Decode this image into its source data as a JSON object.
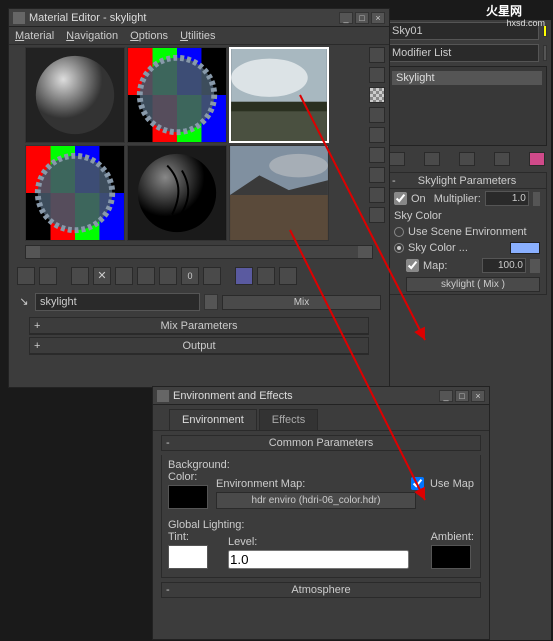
{
  "logo_text": "火星网",
  "logo_sub": "hxsd.com",
  "materialEditor": {
    "title": "Material Editor - skylight",
    "menu": {
      "material": "Material",
      "navigation": "Navigation",
      "options": "Options",
      "utilities": "Utilities"
    },
    "nameField": "skylight",
    "typeBtn": "Mix",
    "rollouts": {
      "mix": "Mix Parameters",
      "output": "Output"
    }
  },
  "modPanel": {
    "nameField": "Sky01",
    "modifierList": "Modifier List",
    "objectType": "Skylight",
    "rollout": "Skylight Parameters",
    "onLabel": "On",
    "multiplierLabel": "Multiplier:",
    "multiplierVal": "1.0",
    "skyColorGroup": "Sky Color",
    "useSceneEnv": "Use Scene Environment",
    "skyColorLabel": "Sky Color ...",
    "mapLabel": "Map:",
    "mapVal": "100.0",
    "mapBtn": "skylight  ( Mix )"
  },
  "env": {
    "title": "Environment and Effects",
    "tabs": {
      "env": "Environment",
      "effects": "Effects"
    },
    "commonParams": "Common Parameters",
    "backgroundLabel": "Background:",
    "colorLabel": "Color:",
    "envMapLabel": "Environment Map:",
    "useMapLabel": "Use Map",
    "mapBtn": "hdr enviro (hdri-06_color.hdr)",
    "globalLighting": "Global Lighting:",
    "tintLabel": "Tint:",
    "levelLabel": "Level:",
    "levelVal": "1.0",
    "ambientLabel": "Ambient:",
    "atmosphere": "Atmosphere"
  }
}
